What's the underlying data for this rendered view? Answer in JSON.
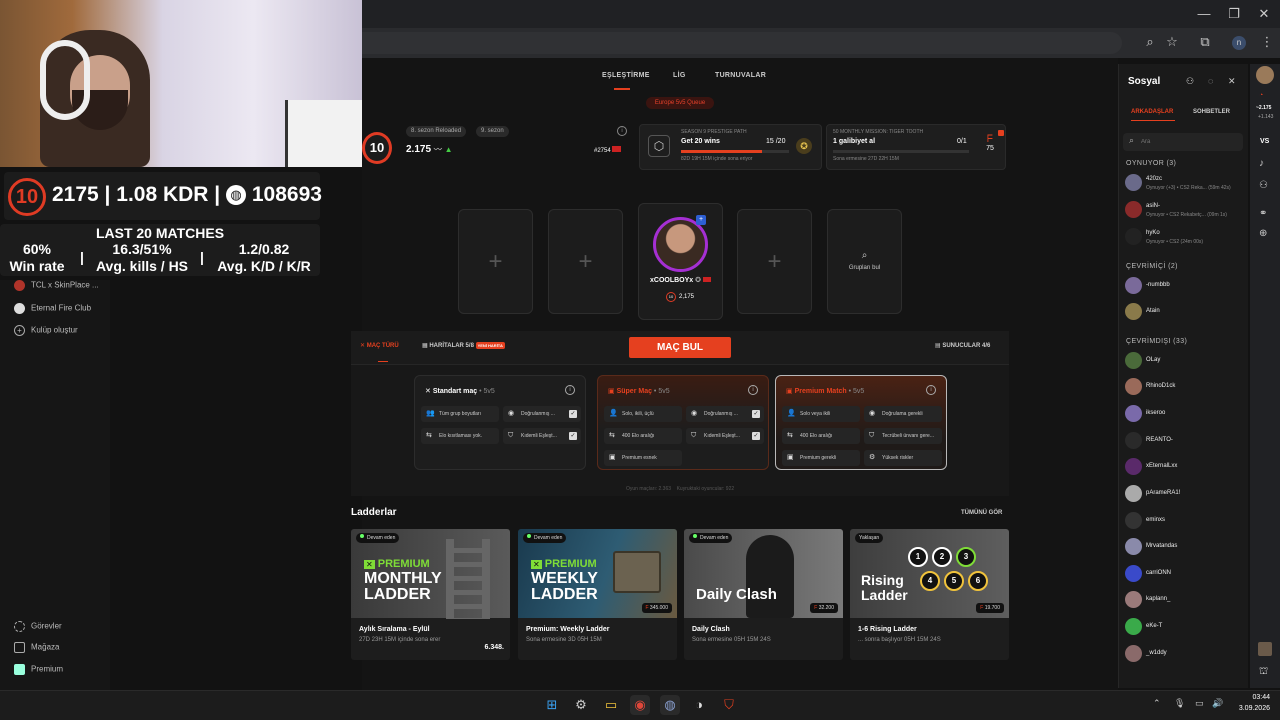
{
  "stream_overlay": {
    "level": "10",
    "elo_kdr_rank": "2175 | 1.08 KDR | ",
    "rank": "108693",
    "last_matches_title": "LAST 20 MATCHES",
    "win_rate_value": "60%",
    "win_rate_label": "Win rate",
    "kills_value": "16.3/51%",
    "kills_label": "Avg. kills / HS",
    "kd_value": "1.2/0.82",
    "kd_label": "Avg. K/D / K/R",
    "sep": "|"
  },
  "left_sidebar": {
    "items": [
      {
        "label": "TCL x SkinPlace ..."
      },
      {
        "label": "Eternal Fire Club"
      },
      {
        "label": "Kulüp oluştur"
      }
    ],
    "bottom": [
      {
        "label": "Görevler"
      },
      {
        "label": "Mağaza"
      },
      {
        "label": "Premium"
      }
    ]
  },
  "nav": {
    "tabs": [
      {
        "label": "EŞLEŞTİRME"
      },
      {
        "label": "LİG"
      },
      {
        "label": "TURNUVALAR"
      }
    ],
    "queue": "Europe 5v5 Queue"
  },
  "profile": {
    "level": "10",
    "season": "8. sezon Reloaded",
    "season2": "9. sezon",
    "elo": "2.175",
    "rank": "#2754",
    "prestige_title": "SEASON 9 PRESTIGE PATH",
    "prestige_goal": "Get 20 wins",
    "prestige_progress": "15 /20",
    "prestige_fraction": 0.75,
    "prestige_time": "82D 19H 15M içinde sona eriyor",
    "mission_title": "50 MONTHLY MISSION: TIGER TOOTH",
    "mission_goal": "1 galibiyet al",
    "mission_progress": "0/1",
    "mission_time": "Sona ermesine 27D 22H 15M",
    "mission_reward": "75"
  },
  "party": {
    "player_name": "xCOOLBOYx",
    "player_elo": "2,175",
    "player_level": "10",
    "find_groups": "Grupları bul"
  },
  "mode_bar": {
    "match_type": "MAÇ TÜRÜ",
    "maps": "HARİTALAR 5/8",
    "maps_badge": "YENİ HARİTA",
    "find_match": "MAÇ BUL",
    "servers": "SUNUCULAR 4/6"
  },
  "modes": [
    {
      "title": "Standart maç",
      "size": " • 5v5",
      "features": [
        {
          "label": "Tüm grup boyutları",
          "check": true
        },
        {
          "label": "Doğrulanmış ...",
          "check": true
        },
        {
          "label": "Elo kısıtlaması yok.",
          "check": false
        },
        {
          "label": "Kıdemli Eşleşt...",
          "check": true
        }
      ]
    },
    {
      "title": "Süper Maç",
      "size": " • 5v5",
      "features": [
        {
          "label": "Solo, ikili, üçlü",
          "check": false
        },
        {
          "label": "Doğrulanmış ...",
          "check": true
        },
        {
          "label": "400 Elo aralığı",
          "check": false
        },
        {
          "label": "Kıdemli Eşleşt...",
          "check": true
        },
        {
          "label": "Premium esnek",
          "check": false
        }
      ]
    },
    {
      "title": "Premium Match",
      "size": " • 5v5",
      "features": [
        {
          "label": "Solo veya ikili",
          "check": false
        },
        {
          "label": "Doğrulama gerekli",
          "check": false
        },
        {
          "label": "400 Elo aralığı",
          "check": false
        },
        {
          "label": "Tecrübeli ünvanı gere...",
          "check": false
        },
        {
          "label": "Premium gerekli",
          "check": false
        },
        {
          "label": "Yüksek riskler",
          "check": false
        }
      ]
    }
  ],
  "online_stats": {
    "playing": "Oyun maçları: 2.363",
    "queued": "Kuyruktaki oyuncular: 922"
  },
  "ladders": {
    "title": "Ladderlar",
    "see_all": "TÜMÜNÜ GÖR",
    "items": [
      {
        "tag": "Devam eden",
        "line1": "PREMIUM",
        "line2": "MONTHLY",
        "line3": "LADDER",
        "name": "Aylık Sıralama - Eylül",
        "sub": "27D 23H 15M içinde sona erer",
        "points": "6.348."
      },
      {
        "tag": "Devam eden",
        "line1": "PREMIUM",
        "line2": "WEEKLY",
        "line3": "LADDER",
        "name": "Premium: Weekly Ladder",
        "sub": "Sona ermesine 3D 05H 15M",
        "prize": "345.000"
      },
      {
        "tag": "Devam eden",
        "line2": "Daily Clash",
        "name": "Daily Clash",
        "sub": "Sona ermesine 05H 15M 24S",
        "prize": "32.200"
      },
      {
        "tag": "Yaklaşan",
        "line2": "Rising",
        "line3": "Ladder",
        "name": "1-6 Rising Ladder",
        "sub": "... sonra başlıyor 05H 15M 24S",
        "prize": "19.700"
      }
    ]
  },
  "social": {
    "title": "Sosyal",
    "tabs": [
      {
        "label": "ARKADAŞLAR"
      },
      {
        "label": "SOHBETLER"
      }
    ],
    "search_placeholder": "Ara",
    "playing_header": "OYNUYOR (3)",
    "playing": [
      {
        "name": "420zc",
        "status": "Oynuyor (+3) • CS2 Reka... (59m 42s)"
      },
      {
        "name": "asiN-",
        "status": "Oynuyor • CS2 Rekabetç... (09m 1s)"
      },
      {
        "name": "hyKo",
        "status": "Oynuyor • CS2 (24m 00s)"
      }
    ],
    "online_header": "ÇEVRİMİÇİ (2)",
    "online": [
      {
        "name": "-numbbb"
      },
      {
        "name": "Atain"
      }
    ],
    "offline_header": "ÇEVRİMDIŞI (33)",
    "offline": [
      {
        "name": "OLay"
      },
      {
        "name": "RhinoD1ck"
      },
      {
        "name": "ikseroo"
      },
      {
        "name": "REANTO-"
      },
      {
        "name": "xEternalLxx"
      },
      {
        "name": "pArameRA1!"
      },
      {
        "name": "eminxs"
      },
      {
        "name": "Mrvatandas"
      },
      {
        "name": "carriONN"
      },
      {
        "name": "kaplann_"
      },
      {
        "name": "eKe-T"
      },
      {
        "name": "_w1ddy"
      }
    ]
  },
  "browser": {
    "rail_elo": "~2.175",
    "rail_delta": "+1.143",
    "rail_vs": "VS"
  },
  "taskbar": {
    "time": "03:44",
    "date": "3.09.2026"
  },
  "colors": {
    "accent": "#e5401f",
    "background": "#141414",
    "panel": "#1e1e1e"
  }
}
